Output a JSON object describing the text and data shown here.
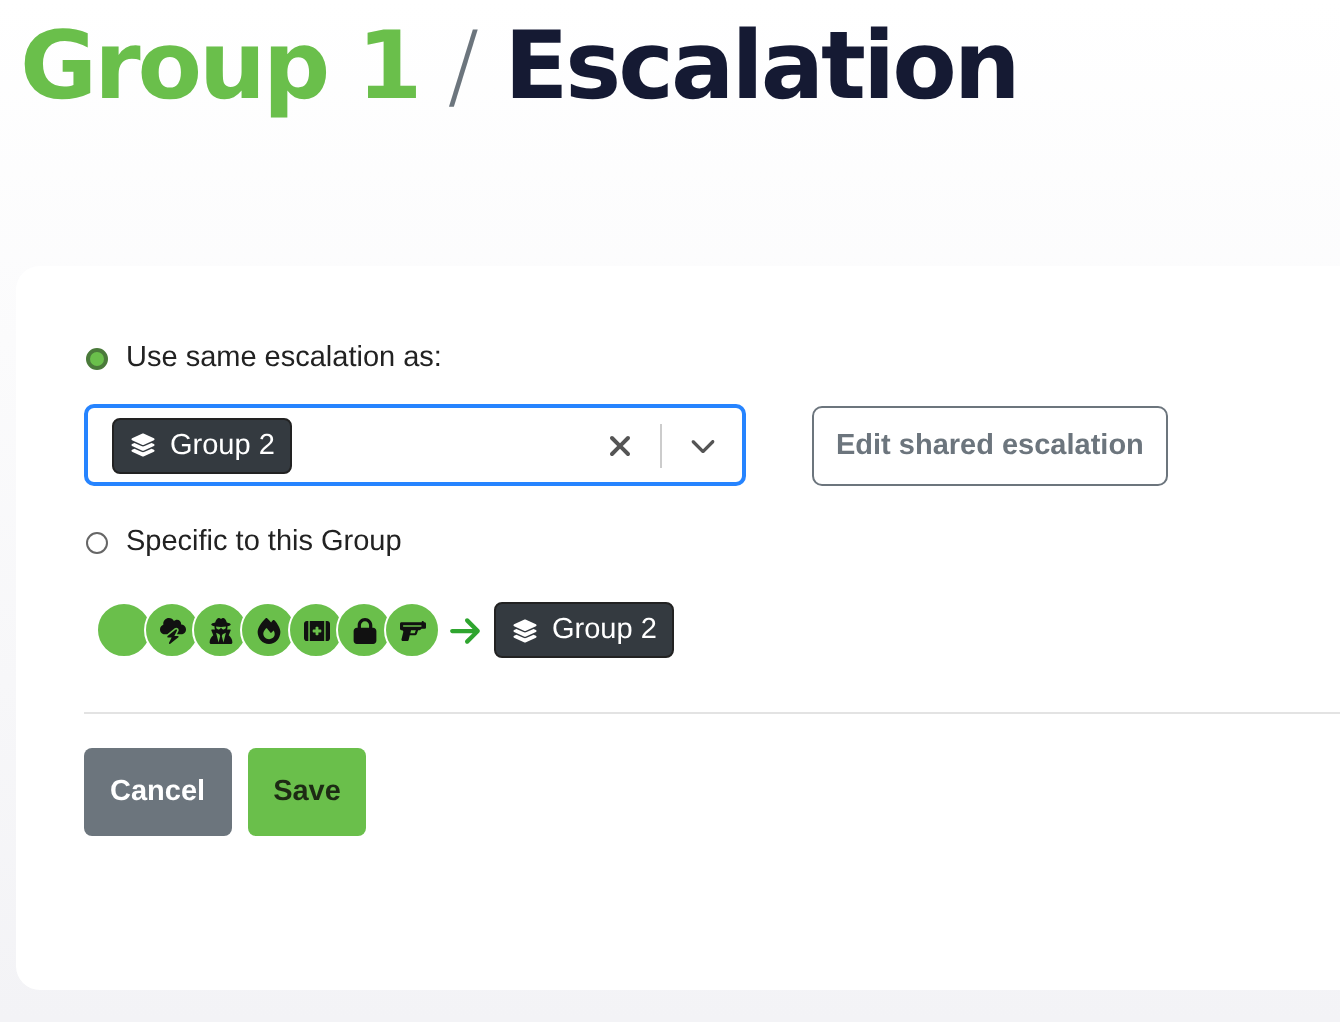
{
  "heading": {
    "group": "Group 1",
    "separator": "/",
    "page": "Escalation"
  },
  "options": [
    {
      "label": "Use same escalation as:",
      "selected": true
    },
    {
      "label": "Specific to this Group",
      "selected": false
    }
  ],
  "select": {
    "value": "Group 2"
  },
  "edit_button": "Edit shared escalation",
  "chain_target": "Group 2",
  "buttons": {
    "cancel": "Cancel",
    "save": "Save"
  }
}
